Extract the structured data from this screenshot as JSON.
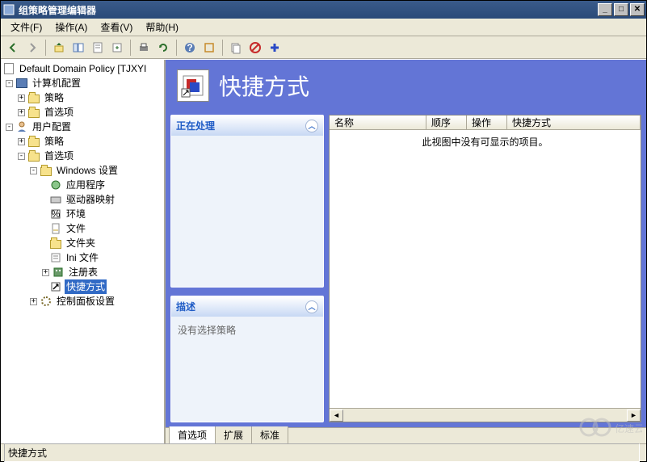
{
  "window": {
    "title": "组策略管理编辑器"
  },
  "menu": {
    "file": "文件(F)",
    "action": "操作(A)",
    "view": "查看(V)",
    "help": "帮助(H)"
  },
  "tree": {
    "root": "Default Domain Policy [TJXYI",
    "computer_config": "计算机配置",
    "policies": "策略",
    "preferences": "首选项",
    "user_config": "用户配置",
    "windows_settings": "Windows 设置",
    "apps": "应用程序",
    "drive_maps": "驱动器映射",
    "environment": "环境",
    "files": "文件",
    "folders": "文件夹",
    "ini_files": "Ini 文件",
    "registry": "注册表",
    "shortcuts": "快捷方式",
    "control_panel": "控制面板设置"
  },
  "header": {
    "title": "快捷方式"
  },
  "cards": {
    "processing_title": "正在处理",
    "description_title": "描述",
    "description_body": "没有选择策略"
  },
  "list": {
    "cols": {
      "name": "名称",
      "order": "顺序",
      "action": "操作",
      "target": "快捷方式"
    },
    "empty": "此视图中没有可显示的项目。"
  },
  "tabs": {
    "pref": "首选项",
    "ext": "扩展",
    "std": "标准"
  },
  "status": {
    "text": "快捷方式"
  },
  "watermark": "亿速云"
}
